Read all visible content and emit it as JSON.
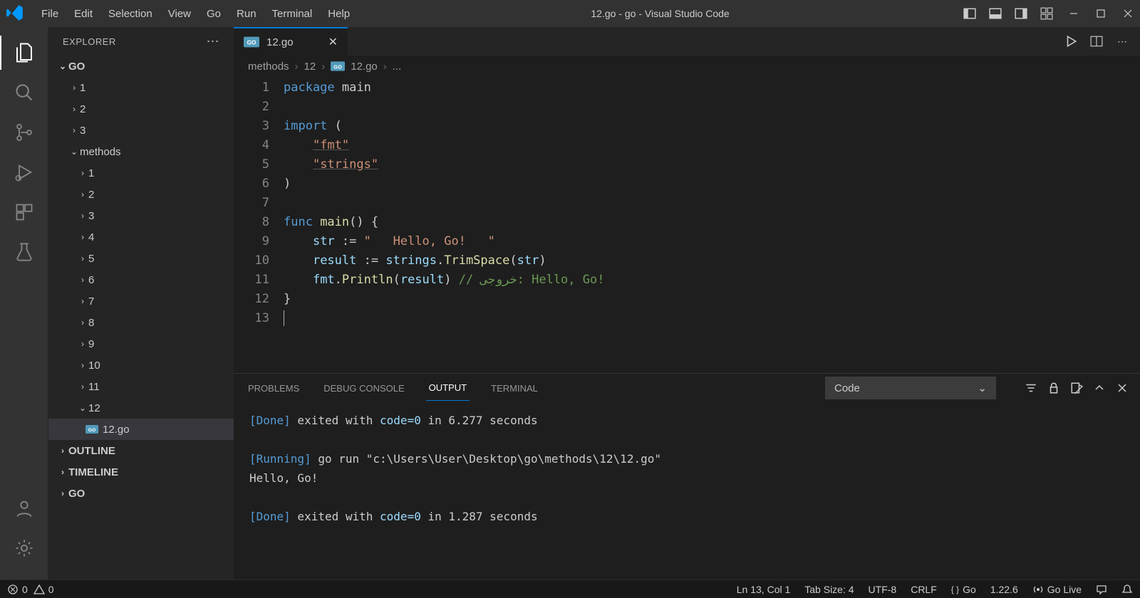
{
  "window_title": "12.go - go - Visual Studio Code",
  "menu": [
    "File",
    "Edit",
    "Selection",
    "View",
    "Go",
    "Run",
    "Terminal",
    "Help"
  ],
  "explorer_title": "EXPLORER",
  "tree": {
    "root": "GO",
    "top_folders": [
      "1",
      "2",
      "3"
    ],
    "methods_label": "methods",
    "method_folders": [
      "1",
      "2",
      "3",
      "4",
      "5",
      "6",
      "7",
      "8",
      "9",
      "10",
      "11",
      "12"
    ],
    "open_file": "12.go",
    "sections": [
      "OUTLINE",
      "TIMELINE",
      "GO"
    ]
  },
  "tab": {
    "label": "12.go"
  },
  "breadcrumb": {
    "p1": "methods",
    "p2": "12",
    "p3": "12.go",
    "p4": "..."
  },
  "code": {
    "lines": [
      "1",
      "2",
      "3",
      "4",
      "5",
      "6",
      "7",
      "8",
      "9",
      "10",
      "11",
      "12",
      "13"
    ],
    "l1_kw": "package",
    "l1_pk": " main",
    "l3_kw": "import",
    "l3_rest": " (",
    "l4": "\"fmt\"",
    "l5": "\"strings\"",
    "l6": ")",
    "l8_kw": "func",
    "l8_fn": " main",
    "l8_rest": "() {",
    "l9_a": "str",
    "l9_op": " := ",
    "l9_s": "\"   Hello, Go!   \"",
    "l10_a": "result",
    "l10_op": " := ",
    "l10_b": "strings",
    "l10_dot": ".",
    "l10_fn": "TrimSpace",
    "l10_c": "(",
    "l10_d": "str",
    "l10_e": ")",
    "l11_a": "fmt",
    "l11_dot": ".",
    "l11_fn": "Println",
    "l11_b": "(",
    "l11_c": "result",
    "l11_d": ") ",
    "l11_com": "// خروجی: Hello, Go!",
    "l12": "}"
  },
  "panel": {
    "problems": "PROBLEMS",
    "debug": "DEBUG CONSOLE",
    "output": "OUTPUT",
    "terminal": "TERMINAL",
    "selector": "Code"
  },
  "output": {
    "line1a": "[Done]",
    "line1b": " exited with ",
    "line1c": "code=0",
    "line1d": " in ",
    "line1e": "6.277",
    "line1f": " seconds",
    "line2a": "[Running]",
    "line2b": " go run \"c:\\Users\\User\\Desktop\\go\\methods\\12\\12.go\"",
    "line3": "Hello, Go!",
    "line4a": "[Done]",
    "line4b": " exited with ",
    "line4c": "code=0",
    "line4d": " in ",
    "line4e": "1.287",
    "line4f": " seconds"
  },
  "status": {
    "errors": "0",
    "warnings": "0",
    "ln_col": "Ln 13, Col 1",
    "tab_size": "Tab Size: 4",
    "encoding": "UTF-8",
    "eol": "CRLF",
    "lang": "Go",
    "go_ver": "1.22.6",
    "live": "Go Live"
  }
}
